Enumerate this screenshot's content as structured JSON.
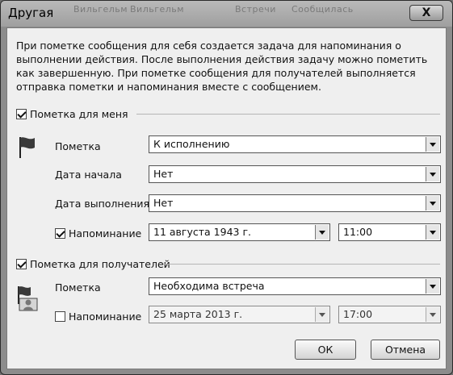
{
  "window": {
    "title": "Другая",
    "close_symbol": "X",
    "background_ghost": [
      "Вильгельм",
      "Вильгельм",
      "Встречи",
      "Сообщилась"
    ]
  },
  "description": "При пометке сообщения для себя создается задача для напоминания о выполнении действия. После выполнения действия задачу можно пометить как завершенную. При пометке сообщения для получателей выполняется отправка пометки и напоминания вместе с сообщением.",
  "self_section": {
    "checkbox_label": "Пометка для меня",
    "checked": true,
    "icon": "flag-icon",
    "flag_label": "Пометка",
    "flag_value": "К исполнению",
    "start_label": "Дата начала",
    "start_value": "Нет",
    "due_label": "Дата выполнения",
    "due_value": "Нет",
    "reminder_label": "Напоминание",
    "reminder_checked": true,
    "reminder_date": "11 августа 1943 г.",
    "reminder_time": "11:00"
  },
  "recipients_section": {
    "checkbox_label": "Пометка для получателей",
    "checked": true,
    "icon": "recipient-flag-icon",
    "flag_label": "Пометка",
    "flag_value": "Необходима встреча",
    "reminder_label": "Напоминание",
    "reminder_checked": false,
    "reminder_date": "25 марта 2013 г.",
    "reminder_time": "17:00"
  },
  "buttons": {
    "ok": "ОК",
    "cancel": "Отмена"
  }
}
